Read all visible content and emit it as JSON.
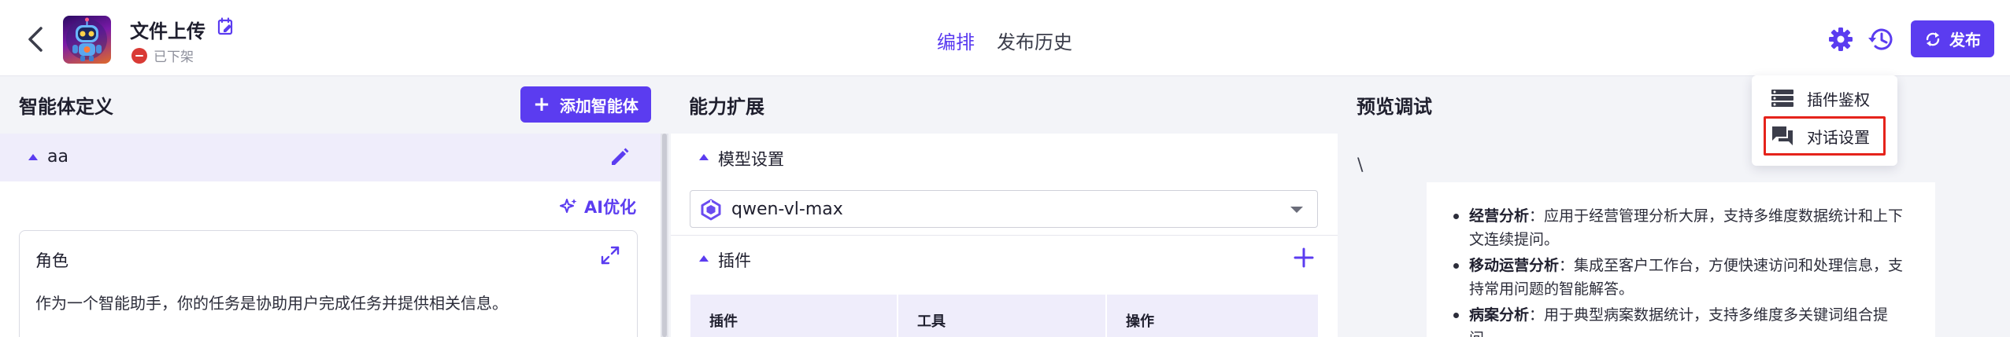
{
  "header": {
    "title": "文件上传",
    "status": "已下架",
    "tabs": [
      {
        "label": "编排",
        "active": true
      },
      {
        "label": "发布历史",
        "active": false
      }
    ],
    "publish_label": "发布",
    "accent_color": "#5b3cf0"
  },
  "menu": {
    "items": [
      {
        "label": "插件鉴权",
        "icon": "list-icon"
      },
      {
        "label": "对话设置",
        "icon": "chat-icon",
        "highlighted": true
      }
    ]
  },
  "left": {
    "title": "智能体定义",
    "add_agent_label": "添加智能体",
    "agent_name": "aa",
    "ai_optimize_label": "AI优化",
    "role_title": "角色",
    "role_text": "作为一个智能助手，你的任务是协助用户完成任务并提供相关信息。"
  },
  "middle": {
    "title": "能力扩展",
    "model_section": "模型设置",
    "model_value": "qwen-vl-max",
    "plugin_section": "插件",
    "table_headers": [
      "插件",
      "工具",
      "操作"
    ]
  },
  "right": {
    "title": "预览调试",
    "backslash": "\\",
    "items": [
      {
        "term": "经营分析",
        "text": "：应用于经营管理分析大屏，支持多维度数据统计和上下文连续提问。"
      },
      {
        "term": "移动运营分析",
        "text": "：集成至客户工作台，方便快速访问和处理信息，支持常用问题的智能解答。"
      },
      {
        "term": "病案分析",
        "text": "：用于典型病案数据统计，支持多维度多关键词组合提问。"
      }
    ]
  }
}
